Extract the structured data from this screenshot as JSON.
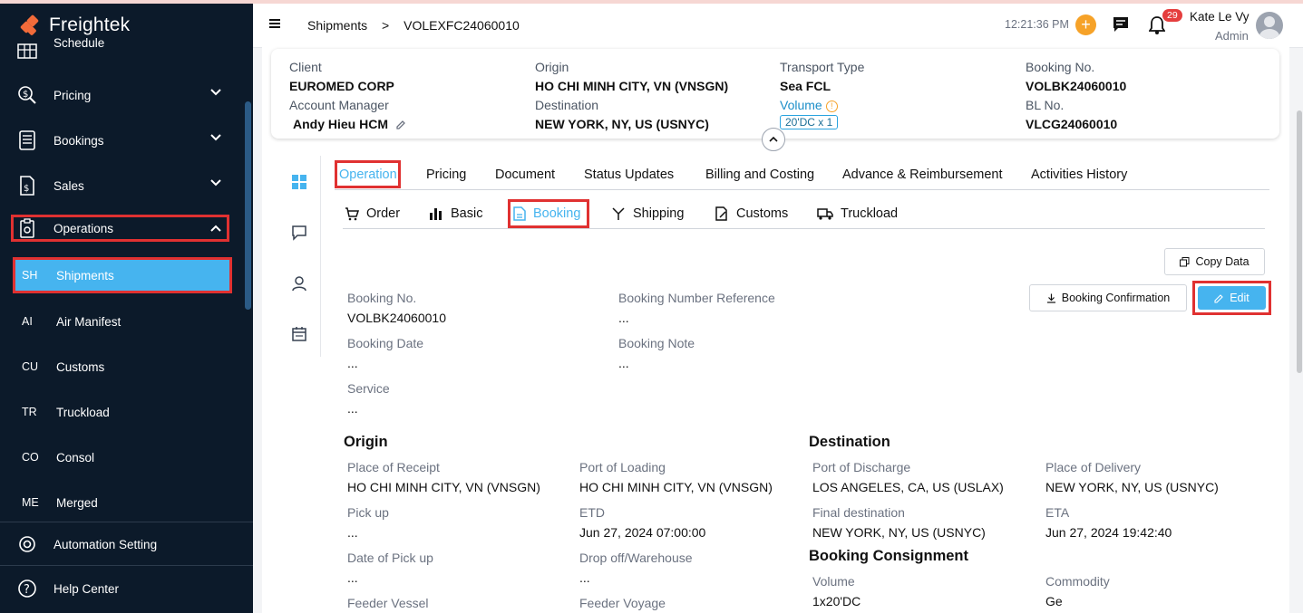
{
  "app": {
    "name": "Freightek"
  },
  "sidebar": {
    "items": [
      {
        "label": "Schedule"
      },
      {
        "label": "Pricing"
      },
      {
        "label": "Bookings"
      },
      {
        "label": "Sales"
      },
      {
        "label": "Operations"
      }
    ],
    "sub_items": [
      {
        "abbr": "SH",
        "label": "Shipments"
      },
      {
        "abbr": "AI",
        "label": "Air Manifest"
      },
      {
        "abbr": "CU",
        "label": "Customs"
      },
      {
        "abbr": "TR",
        "label": "Truckload"
      },
      {
        "abbr": "CO",
        "label": "Consol"
      },
      {
        "abbr": "ME",
        "label": "Merged"
      }
    ],
    "footer": [
      {
        "label": "Automation Setting"
      },
      {
        "label": "Help Center"
      }
    ]
  },
  "header": {
    "breadcrumb": {
      "parent": "Shipments",
      "separator": ">",
      "current": "VOLEXFC24060010"
    },
    "time": "12:21:36 PM",
    "plus": "+",
    "notification_count": "29",
    "user": {
      "name": "Kate Le Vy",
      "role": "Admin"
    }
  },
  "summary": {
    "client_label": "Client",
    "client": "EUROMED CORP",
    "account_manager_label": "Account Manager",
    "account_manager": "Andy Hieu HCM",
    "origin_label": "Origin",
    "origin": "HO CHI MINH CITY, VN (VNSGN)",
    "destination_label": "Destination",
    "destination": "NEW YORK, NY, US (USNYC)",
    "transport_type_label": "Transport Type",
    "transport_type": "Sea FCL",
    "volume_label": "Volume",
    "volume": "20'DC x 1",
    "booking_no_label": "Booking No.",
    "booking_no": "VOLBK24060010",
    "bl_no_label": "BL No.",
    "bl_no": "VLCG24060010"
  },
  "tabs": [
    "Operation",
    "Pricing",
    "Document",
    "Status Updates",
    "Billing and Costing",
    "Advance & Reimbursement",
    "Activities History"
  ],
  "subtabs": [
    "Order",
    "Basic",
    "Booking",
    "Shipping",
    "Customs",
    "Truckload"
  ],
  "buttons": {
    "copy_data": "Copy Data",
    "booking_confirmation": "Booking Confirmation",
    "edit": "Edit"
  },
  "booking": {
    "booking_no_label": "Booking No.",
    "booking_no": "VOLBK24060010",
    "booking_ref_label": "Booking Number Reference",
    "booking_ref": "...",
    "booking_date_label": "Booking Date",
    "booking_date": "...",
    "booking_note_label": "Booking Note",
    "booking_note": "...",
    "service_label": "Service",
    "service": "..."
  },
  "origin_section": {
    "title": "Origin",
    "place_of_receipt_label": "Place of Receipt",
    "place_of_receipt": "HO CHI MINH CITY, VN (VNSGN)",
    "port_of_loading_label": "Port of Loading",
    "port_of_loading": "HO CHI MINH CITY, VN (VNSGN)",
    "pick_up_label": "Pick up",
    "pick_up": "...",
    "etd_label": "ETD",
    "etd": "Jun 27, 2024 07:00:00",
    "date_pick_up_label": "Date of Pick up",
    "date_pick_up": "...",
    "drop_off_label": "Drop off/Warehouse",
    "drop_off": "...",
    "feeder_vessel_label": "Feeder Vessel",
    "feeder_voyage_label": "Feeder Voyage"
  },
  "destination_section": {
    "title": "Destination",
    "port_of_discharge_label": "Port of Discharge",
    "port_of_discharge": "LOS ANGELES, CA, US (USLAX)",
    "place_of_delivery_label": "Place of Delivery",
    "place_of_delivery": "NEW YORK, NY, US (USNYC)",
    "final_destination_label": "Final destination",
    "final_destination": "NEW YORK, NY, US (USNYC)",
    "eta_label": "ETA",
    "eta": "Jun 27, 2024 19:42:40"
  },
  "consignment_section": {
    "title": "Booking Consignment",
    "volume_label": "Volume",
    "volume": "1x20'DC",
    "commodity_label": "Commodity",
    "commodity": "Ge"
  },
  "colors": {
    "accent": "#46b4ef",
    "sidebar_bg": "#0c1a2a",
    "highlight": "#e03131",
    "warning": "#f6a228"
  }
}
